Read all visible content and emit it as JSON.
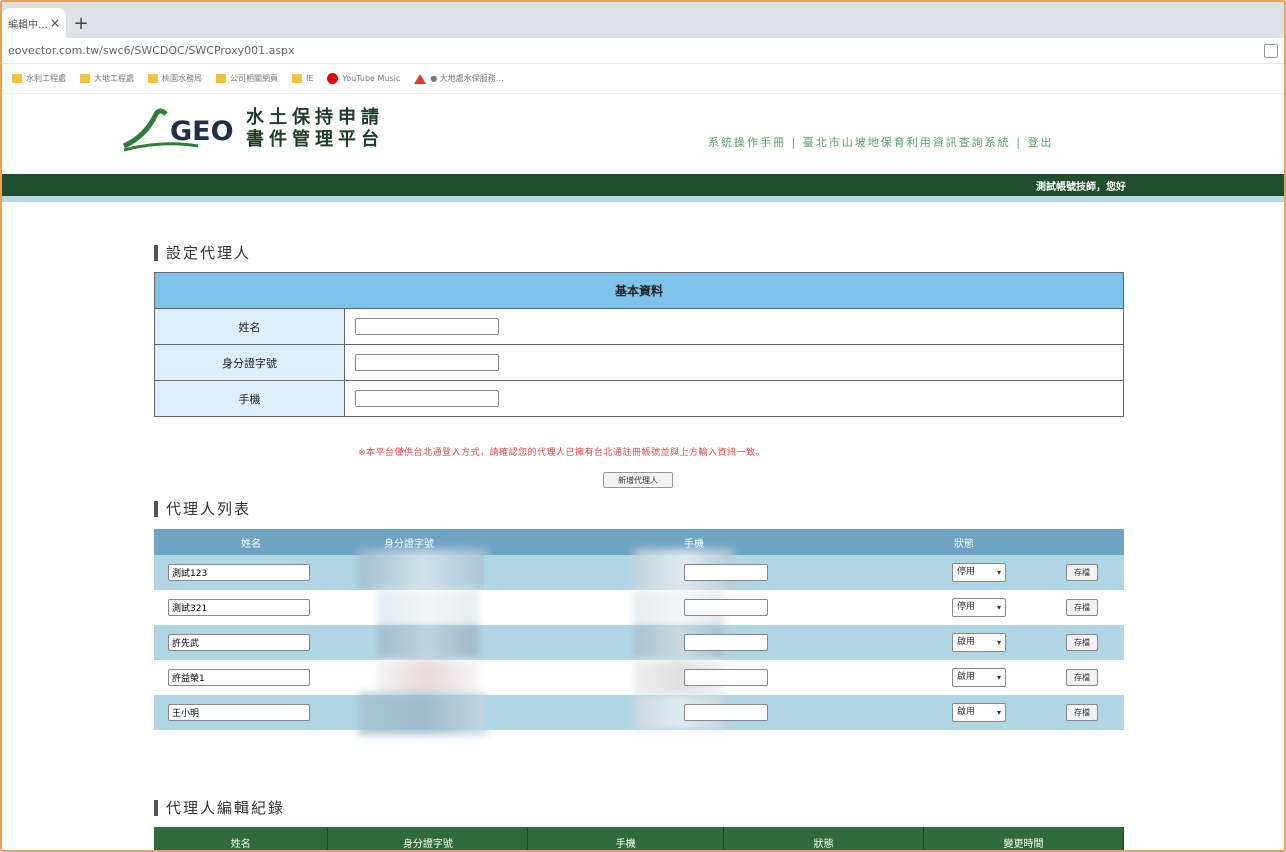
{
  "browser": {
    "tab_title": "編輯中…",
    "tab_close": "×",
    "new_tab": "+",
    "url": "eovector.com.tw/swc6/SWCDOC/SWCProxy001.aspx",
    "bookmarks": [
      {
        "icon": "folder-icon",
        "label": "水利工程處"
      },
      {
        "icon": "folder-icon",
        "label": "大地工程處"
      },
      {
        "icon": "folder-icon",
        "label": "桃園水務局"
      },
      {
        "icon": "folder-icon",
        "label": "公司相關網頁"
      },
      {
        "icon": "folder-icon",
        "label": "IE"
      },
      {
        "icon": "youtube-icon",
        "label": "YouTube Music"
      },
      {
        "icon": "warning-icon",
        "label": "● 大地處水保服務…"
      }
    ]
  },
  "site": {
    "logo_text": "GEO",
    "title_line1": "水土保持申請",
    "title_line2": "書件管理平台",
    "links": [
      "系統操作手冊",
      "臺北市山坡地保育利用資訊查詢系統",
      "登出"
    ],
    "greeting": "測試帳號技師，您好",
    "brand_color": "#1f4e2c"
  },
  "setup": {
    "title": "設定代理人",
    "caption": "基本資料",
    "fields": [
      {
        "label": "姓名",
        "value": ""
      },
      {
        "label": "身分證字號",
        "value": ""
      },
      {
        "label": "手機",
        "value": ""
      }
    ],
    "notice": "※本平台僅供台北通登入方式，請確認您的代理人已擁有台北通註冊帳號並與上方輸入資訊一致。",
    "add_button": "新增代理人"
  },
  "agents": {
    "title": "代理人列表",
    "headers": [
      "姓名",
      "身分證字號",
      "手機",
      "狀態",
      ""
    ],
    "rows": [
      {
        "name": "測試123",
        "status": "停用",
        "save": "存檔"
      },
      {
        "name": "測試321",
        "status": "停用",
        "save": "存檔"
      },
      {
        "name": "許先武",
        "status": "啟用",
        "save": "存檔"
      },
      {
        "name": "許益榮1",
        "status": "啟用",
        "save": "存檔"
      },
      {
        "name": "王小明",
        "status": "啟用",
        "save": "存檔"
      }
    ]
  },
  "history": {
    "title": "代理人編輯紀錄",
    "headers": [
      "姓名",
      "身分證字號",
      "手機",
      "狀態",
      "變更時間"
    ]
  }
}
